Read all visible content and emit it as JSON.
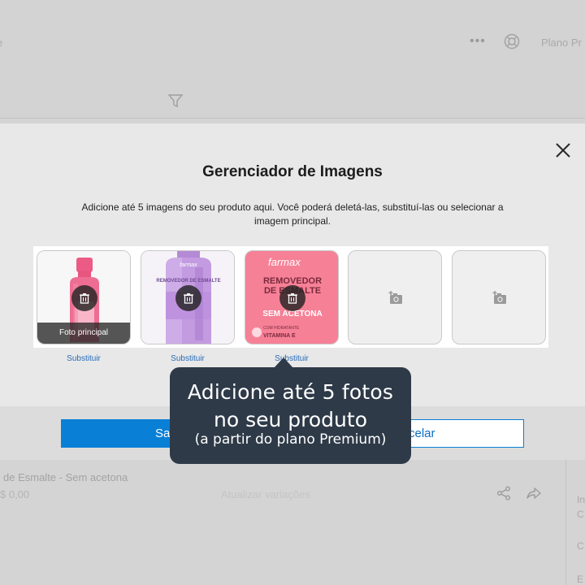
{
  "background": {
    "plan_text": "Plano Pr",
    "left_fragment": "e",
    "more_icon": "ellipsis-icon",
    "help_icon": "help-lifebuoy-icon",
    "filter_icon": "filter-icon",
    "product_name": "de Esmalte - Sem acetona",
    "product_price": "$ 0,00",
    "faint_center_text": "Atualizar variações",
    "share_icon": "share-icon",
    "forward_icon": "forward-icon",
    "side_items": [
      "In",
      "C",
      "C",
      "E"
    ]
  },
  "modal": {
    "title": "Gerenciador de Imagens",
    "description": "Adicione até 5 imagens do seu produto aqui. Você poderá deletá-las, substituí-las ou selecionar a imagem principal.",
    "close_icon": "close-icon",
    "slots": [
      {
        "kind": "image",
        "product": "nail polish remover bottle (pink, small)",
        "main_label": "Foto principal",
        "replace_label": "Substituir"
      },
      {
        "kind": "image",
        "product": "farmax Removedor de Esmalte bottle (purple)",
        "brand_text": "farmax",
        "product_text": "REMOVEDOR DE ESMALTE",
        "replace_label": "Substituir"
      },
      {
        "kind": "image",
        "product": "farmax Removedor de Esmalte label close-up (pink)",
        "brand_text": "farmax",
        "label_line1": "REMOVEDOR",
        "label_line2": "DE ESMALTE",
        "label_line3": "SEM ACETONA",
        "label_line4": "COM HIDRATANTE",
        "label_line5": "VITAMINA E",
        "replace_label": "Substituir"
      },
      {
        "kind": "empty",
        "icon": "add-photo-icon"
      },
      {
        "kind": "empty",
        "icon": "add-photo-icon"
      }
    ],
    "save_label": "Sa",
    "cancel_label": "celar"
  },
  "tooltip": {
    "line1": "Adicione até 5 fotos",
    "line2": "no seu produto",
    "line3": "(a partir do plano Premium)"
  },
  "colors": {
    "accent_blue": "#0a7fd6",
    "tooltip_bg": "#2e3a48",
    "link_blue": "#2a6cb8"
  }
}
